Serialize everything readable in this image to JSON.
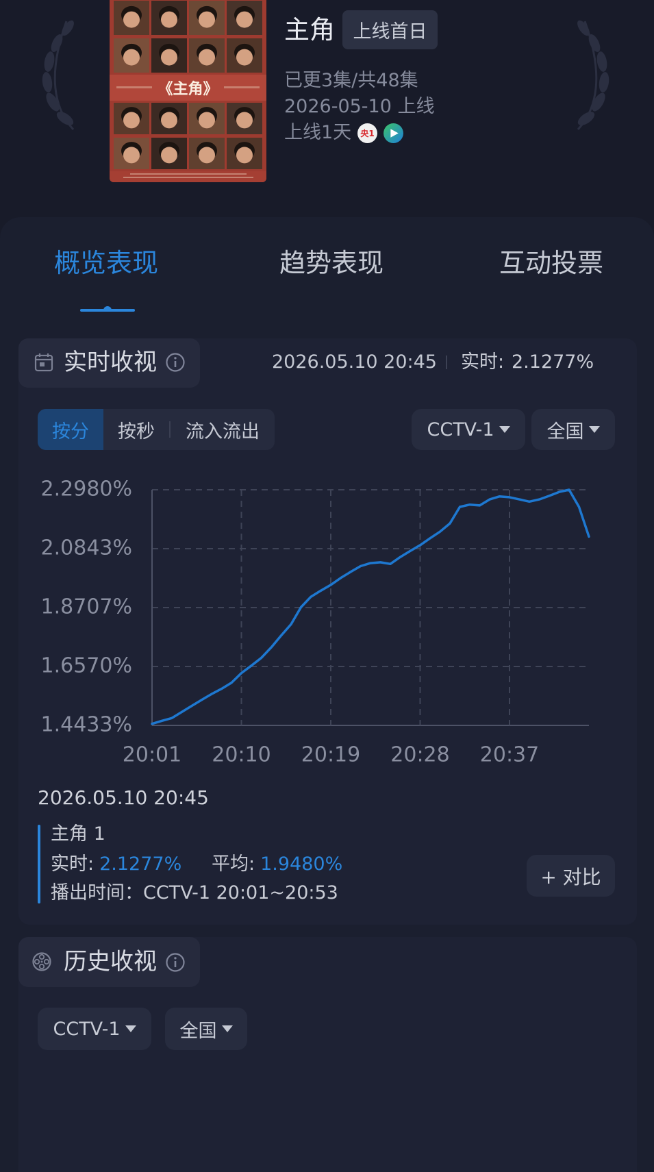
{
  "header": {
    "poster_title": "《主角》",
    "title": "主角",
    "badge": "上线首日",
    "episodes": "已更3集/共48集",
    "release": "2026-05-10 上线",
    "days_online": "上线1天",
    "cctv_badge": "央1",
    "icons": [
      "laurel-icon",
      "cctv1-icon",
      "play-icon"
    ]
  },
  "tabs": [
    {
      "label": "概览表现",
      "active": true
    },
    {
      "label": "趋势表现",
      "active": false
    },
    {
      "label": "互动投票",
      "active": false
    }
  ],
  "realtime": {
    "section_title": "实时收视",
    "icon": "calendar-icon",
    "timestamp": "2026.05.10 20:45",
    "live_label": "实时:",
    "live_value": "2.1277%",
    "modes": [
      {
        "label": "按分",
        "active": true
      },
      {
        "label": "按秒",
        "active": false
      },
      {
        "label": "流入流出",
        "active": false
      }
    ],
    "channel_select": "CCTV-1",
    "region_select": "全国"
  },
  "chart_data": {
    "type": "line",
    "x": [
      "20:01",
      "20:02",
      "20:03",
      "20:04",
      "20:05",
      "20:06",
      "20:07",
      "20:08",
      "20:09",
      "20:10",
      "20:11",
      "20:12",
      "20:13",
      "20:14",
      "20:15",
      "20:16",
      "20:17",
      "20:18",
      "20:19",
      "20:20",
      "20:21",
      "20:22",
      "20:23",
      "20:24",
      "20:25",
      "20:26",
      "20:27",
      "20:28",
      "20:29",
      "20:30",
      "20:31",
      "20:32",
      "20:33",
      "20:34",
      "20:35",
      "20:36",
      "20:37",
      "20:38",
      "20:39",
      "20:40",
      "20:41",
      "20:42",
      "20:43",
      "20:44",
      "20:45"
    ],
    "series": [
      {
        "values": [
          1.449,
          1.46,
          1.47,
          1.492,
          1.514,
          1.536,
          1.557,
          1.576,
          1.598,
          1.633,
          1.66,
          1.688,
          1.726,
          1.769,
          1.81,
          1.872,
          1.91,
          1.932,
          1.953,
          1.978,
          2.0,
          2.021,
          2.032,
          2.035,
          2.029,
          2.054,
          2.076,
          2.097,
          2.122,
          2.146,
          2.176,
          2.236,
          2.244,
          2.241,
          2.263,
          2.274,
          2.271,
          2.263,
          2.255,
          2.263,
          2.276,
          2.29,
          2.298,
          2.236,
          2.128
        ]
      }
    ],
    "x_ticks": [
      "20:01",
      "20:10",
      "20:19",
      "20:28",
      "20:37"
    ],
    "y_ticks": [
      "2.2980%",
      "2.0843%",
      "1.8707%",
      "1.6570%",
      "1.4433%"
    ],
    "xlim": [
      "20:01",
      "20:45"
    ],
    "ylim": [
      1.4433,
      2.298
    ],
    "grid": true,
    "line_color": "#1e78d0"
  },
  "summary": {
    "timestamp": "2026.05.10 20:45",
    "program": "主角 1",
    "live_label": "实时:",
    "live_value": "2.1277%",
    "average_label": "平均:",
    "average_value": "1.9480%",
    "airtime": "播出时间：CCTV-1 20:01~20:53",
    "compare_button": "+ 对比"
  },
  "history": {
    "section_title": "历史收视",
    "icon": "film-reel-icon",
    "channel_select": "CCTV-1",
    "region_select": "全国"
  },
  "colors": {
    "accent": "#2b86dc",
    "background": "#181b29",
    "panel": "#1b1f2f",
    "muted_text": "#8a8fa0"
  }
}
